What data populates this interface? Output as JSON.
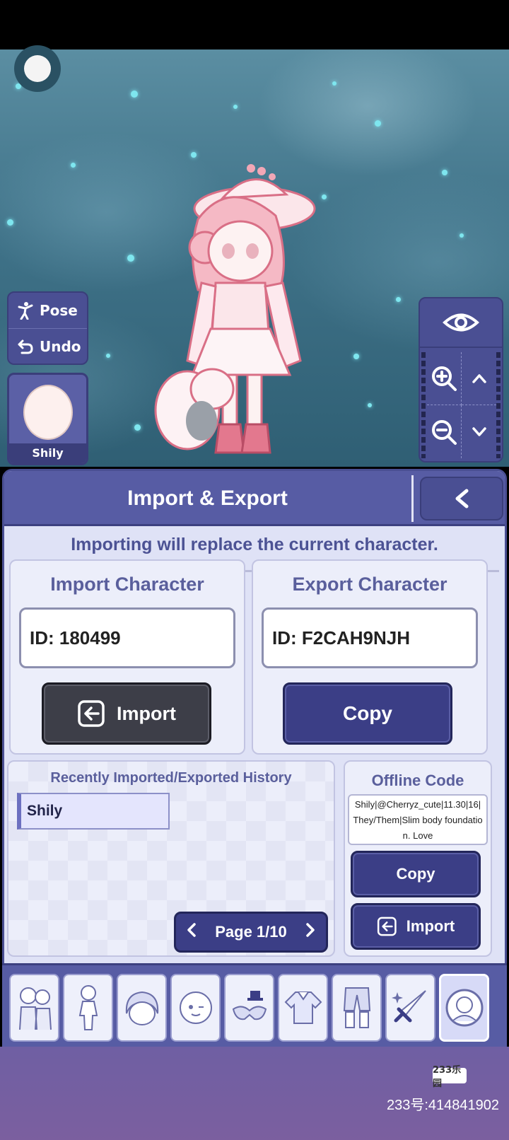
{
  "toolbar": {
    "pose_label": "Pose",
    "undo_label": "Undo"
  },
  "character_slot": {
    "name": "Shily"
  },
  "dialog": {
    "title": "Import & Export",
    "notice": "Importing will replace the current character.",
    "import_section": {
      "title": "Import Character",
      "id_value": "ID: 180499",
      "button_label": "Import"
    },
    "export_section": {
      "title": "Export Character",
      "id_value": "ID: F2CAH9NJH",
      "button_label": "Copy"
    },
    "history": {
      "title": "Recently Imported/Exported History",
      "items": [
        "Shily"
      ],
      "page_label": "Page 1/10"
    },
    "offline": {
      "title": "Offline Code",
      "code": "Shily|@Cherryz_cute|11.30|16|They/Them|Slim body foundation. Love",
      "copy_label": "Copy",
      "import_label": "Import"
    }
  },
  "tabs": [
    {
      "icon": "group-icon"
    },
    {
      "icon": "body-icon"
    },
    {
      "icon": "hair-icon"
    },
    {
      "icon": "face-icon"
    },
    {
      "icon": "accessory-icon"
    },
    {
      "icon": "top-icon"
    },
    {
      "icon": "bottom-icon"
    },
    {
      "icon": "weapon-icon"
    },
    {
      "icon": "profile-icon"
    }
  ],
  "watermark": {
    "logo": "233乐园",
    "id": "233号:414841902"
  },
  "colors": {
    "panel": "#575ca4",
    "dialog_bg": "#dfe2f6",
    "accent_text": "#4c5294",
    "button_dark": "#3d3e48",
    "button_indigo": "#3b3e86"
  }
}
